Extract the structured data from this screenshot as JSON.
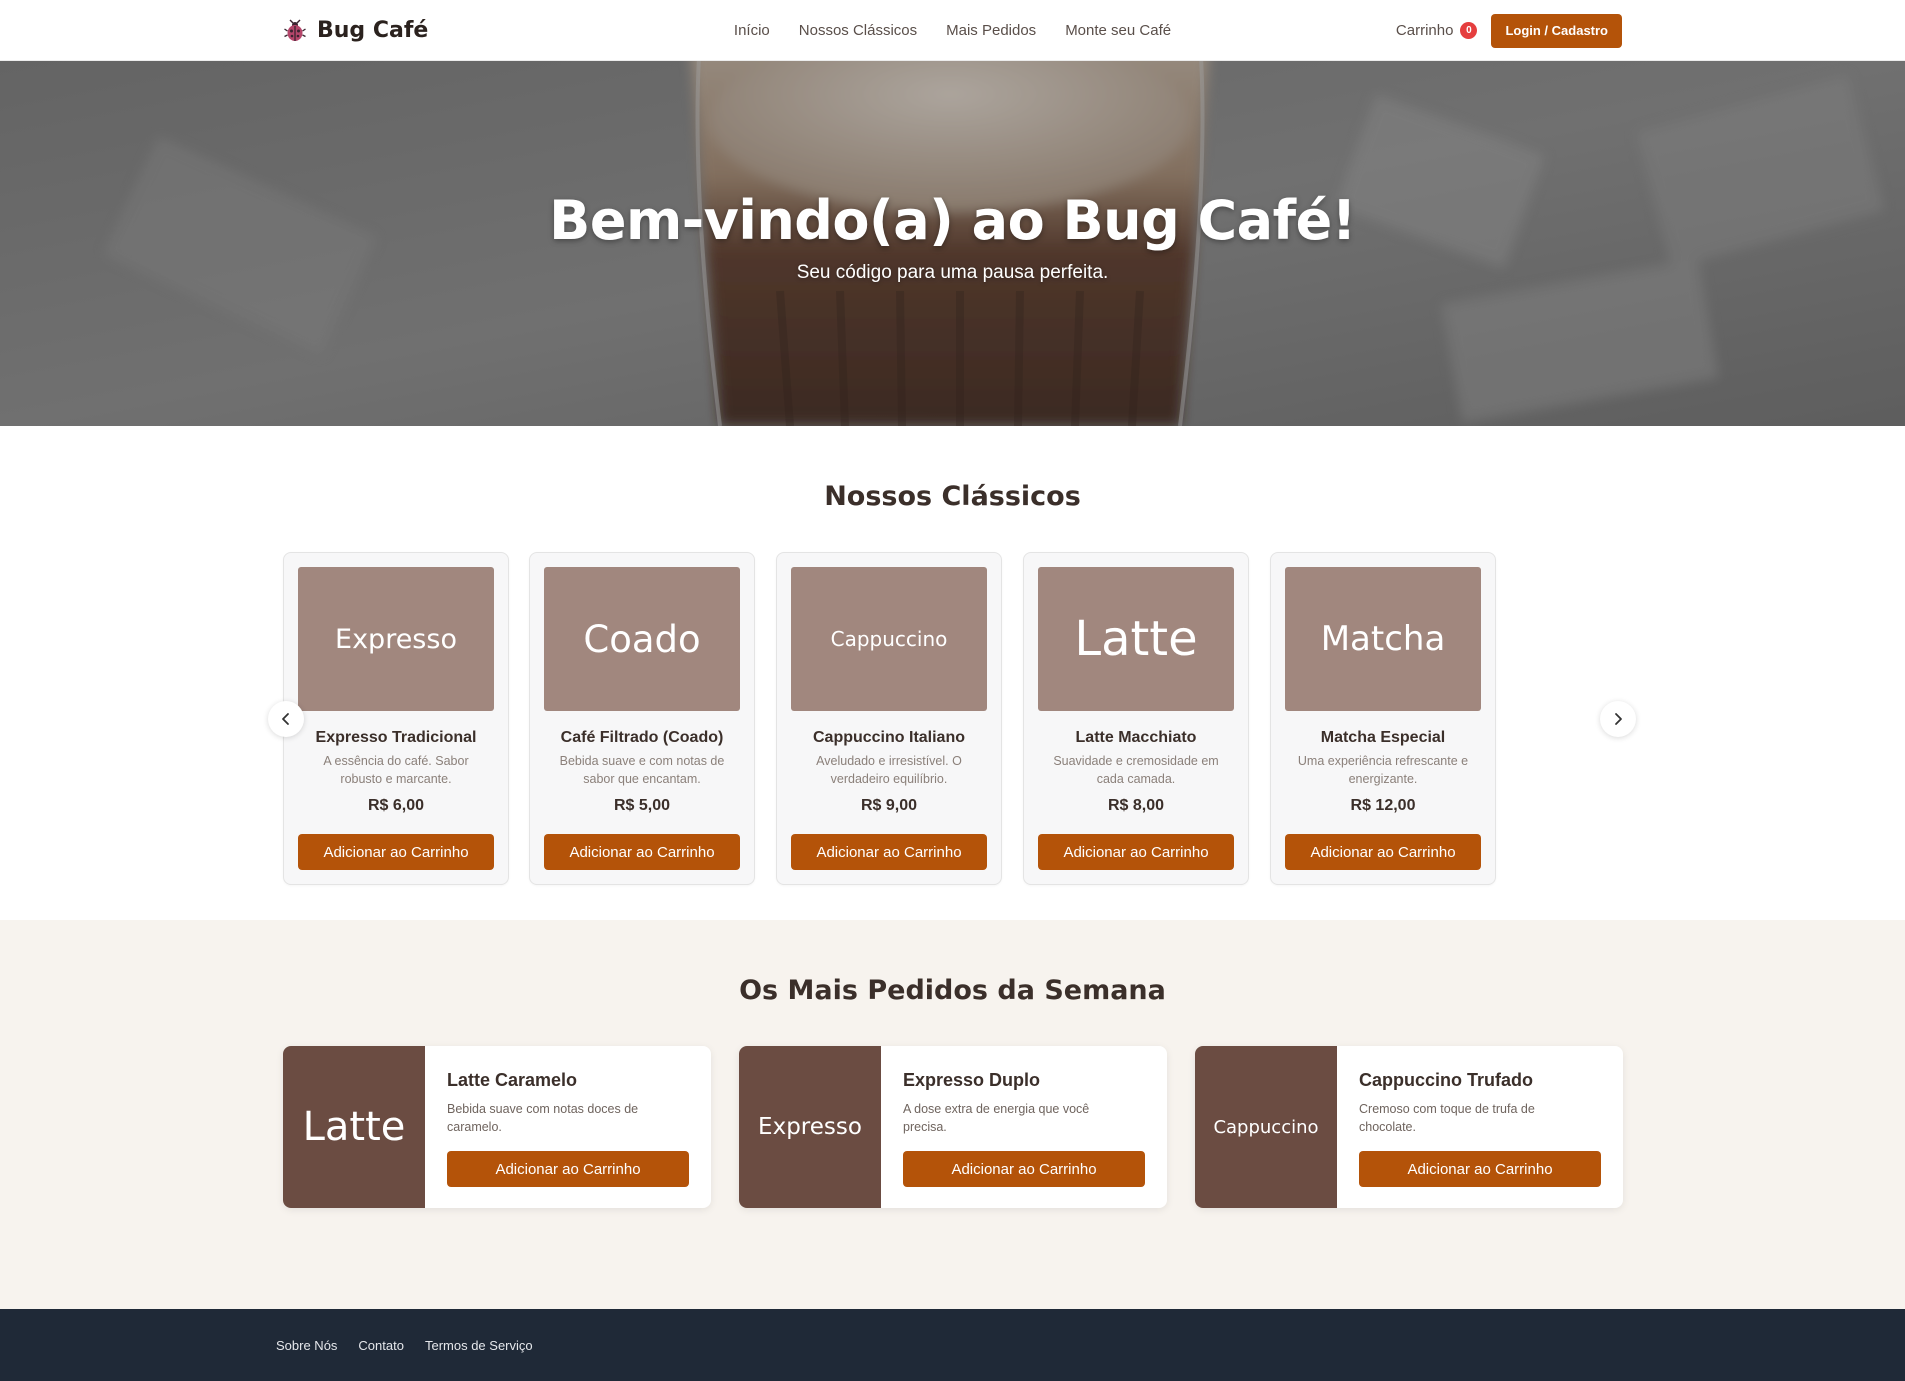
{
  "navbar": {
    "brand": "Bug Café",
    "brand_icon": "ladybug-icon",
    "links": [
      "Início",
      "Nossos Clássicos",
      "Mais Pedidos",
      "Monte seu Café"
    ],
    "cart_label": "Carrinho",
    "cart_count": "0",
    "login_label": "Login / Cadastro"
  },
  "hero": {
    "title": "Bem-vindo(a) ao Bug Café!",
    "subtitle": "Seu código para uma pausa perfeita."
  },
  "classics": {
    "title": "Nossos Clássicos",
    "items": [
      {
        "image_text": "Expresso",
        "name": "Expresso Tradicional",
        "desc": "A essência do café. Sabor robusto e marcante.",
        "price": "R$ 6,00",
        "button": "Adicionar ao Carrinho"
      },
      {
        "image_text": "Coado",
        "name": "Café Filtrado (Coado)",
        "desc": "Bebida suave e com notas de sabor que encantam.",
        "price": "R$ 5,00",
        "button": "Adicionar ao Carrinho"
      },
      {
        "image_text": "Cappuccino",
        "name": "Cappuccino Italiano",
        "desc": "Aveludado e irresistível. O verdadeiro equilíbrio.",
        "price": "R$ 9,00",
        "button": "Adicionar ao Carrinho"
      },
      {
        "image_text": "Latte",
        "name": "Latte Macchiato",
        "desc": "Suavidade e cremosidade em cada camada.",
        "price": "R$ 8,00",
        "button": "Adicionar ao Carrinho"
      },
      {
        "image_text": "Matcha",
        "name": "Matcha Especial",
        "desc": "Uma experiência refrescante e energizante.",
        "price": "R$ 12,00",
        "button": "Adicionar ao Carrinho"
      }
    ]
  },
  "best": {
    "title": "Os Mais Pedidos da Semana",
    "items": [
      {
        "image_text": "Latte",
        "name": "Latte Caramelo",
        "desc": "Bebida suave com notas doces de caramelo.",
        "button": "Adicionar ao Carrinho"
      },
      {
        "image_text": "Expresso",
        "name": "Expresso Duplo",
        "desc": "A dose extra de energia que você precisa.",
        "button": "Adicionar ao Carrinho"
      },
      {
        "image_text": "Cappuccino",
        "name": "Cappuccino Trufado",
        "desc": "Cremoso com toque de trufa de chocolate.",
        "button": "Adicionar ao Carrinho"
      }
    ]
  },
  "footer": {
    "links": [
      "Sobre Nós",
      "Contato",
      "Termos de Serviço"
    ]
  },
  "colors": {
    "accent": "#b45309",
    "card_image": "#a1877e",
    "best_image": "#6b4c42",
    "footer": "#1f2937",
    "badge": "#e53e3e"
  }
}
